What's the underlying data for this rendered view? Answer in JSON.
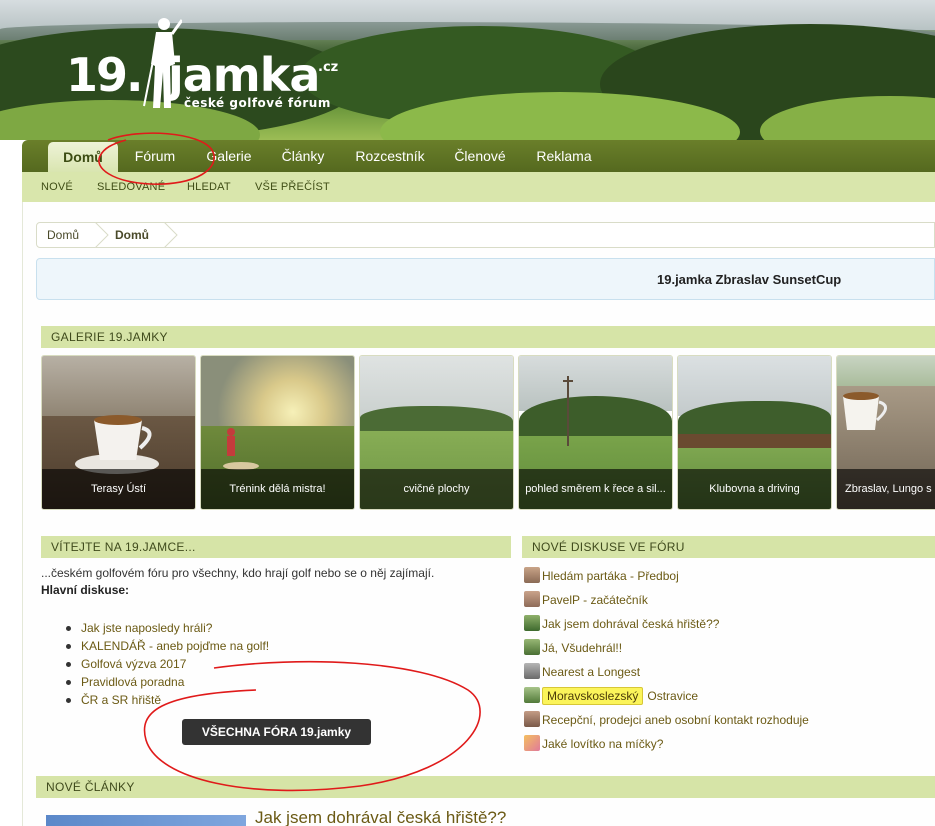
{
  "logo": {
    "number": "19.",
    "name": "jamka",
    "tld": ".cz",
    "tagline": "české golfové fórum"
  },
  "nav": {
    "items": [
      {
        "label": "Domů",
        "active": true
      },
      {
        "label": "Fórum",
        "active": false
      },
      {
        "label": "Galerie",
        "active": false
      },
      {
        "label": "Články",
        "active": false
      },
      {
        "label": "Rozcestník",
        "active": false
      },
      {
        "label": "Členové",
        "active": false
      },
      {
        "label": "Reklama",
        "active": false
      }
    ],
    "sub_items": [
      "NOVÉ",
      "SLEDOVANÉ",
      "HLEDAT",
      "VŠE PŘEČÍST"
    ]
  },
  "breadcrumb": [
    "Domů",
    "Domů"
  ],
  "notice": "19.jamka Zbraslav SunsetCup",
  "gallery": {
    "title": "GALERIE 19.JAMKY",
    "items": [
      {
        "caption": "Terasy Ústí"
      },
      {
        "caption": "Trénink dělá mistra!"
      },
      {
        "caption": "cvičné plochy"
      },
      {
        "caption": "pohled směrem k řece a sil..."
      },
      {
        "caption": "Klubovna a driving"
      },
      {
        "caption": "Zbraslav, Lungo s"
      }
    ]
  },
  "welcome": {
    "title": "VÍTEJTE NA 19.JAMCE...",
    "intro": "...českém golfovém fóru pro všechny, kdo hrají golf nebo se o něj zajímají.",
    "heading": "Hlavní diskuse:",
    "links": [
      "Jak jste naposledy hráli?",
      "KALENDÁŘ - aneb pojďme na golf!",
      "Golfová výzva 2017",
      "Pravidlová poradna",
      "ČR a SR hřiště"
    ],
    "all_button": "VŠECHNA FÓRA 19.jamky"
  },
  "discussions": {
    "title": "NOVÉ DISKUSE VE FÓRU",
    "items": [
      {
        "tag": "",
        "text": "Hledám partáka - Předboj"
      },
      {
        "tag": "",
        "text": "PavelP - začátečník"
      },
      {
        "tag": "",
        "text": "Jak jsem dohrával česká hřiště??"
      },
      {
        "tag": "",
        "text": "Já, Všudehrál!!"
      },
      {
        "tag": "",
        "text": "Nearest a Longest"
      },
      {
        "tag": "Moravskoslezský",
        "text": "Ostravice"
      },
      {
        "tag": "",
        "text": "Recepční, prodejci aneb osobní kontakt rozhoduje"
      },
      {
        "tag": "",
        "text": "Jaké lovítko na míčky?"
      }
    ]
  },
  "articles": {
    "title": "NOVÉ ČLÁNKY",
    "first_title": "Jak jsem dohrával česká hřiště??"
  },
  "colors": {
    "nav_bg": "#5f7425",
    "subnav_bg": "#d9e6ac",
    "section_bg": "#d6e4a7",
    "link": "#6b5a14",
    "annotation": "#e01a1a"
  }
}
